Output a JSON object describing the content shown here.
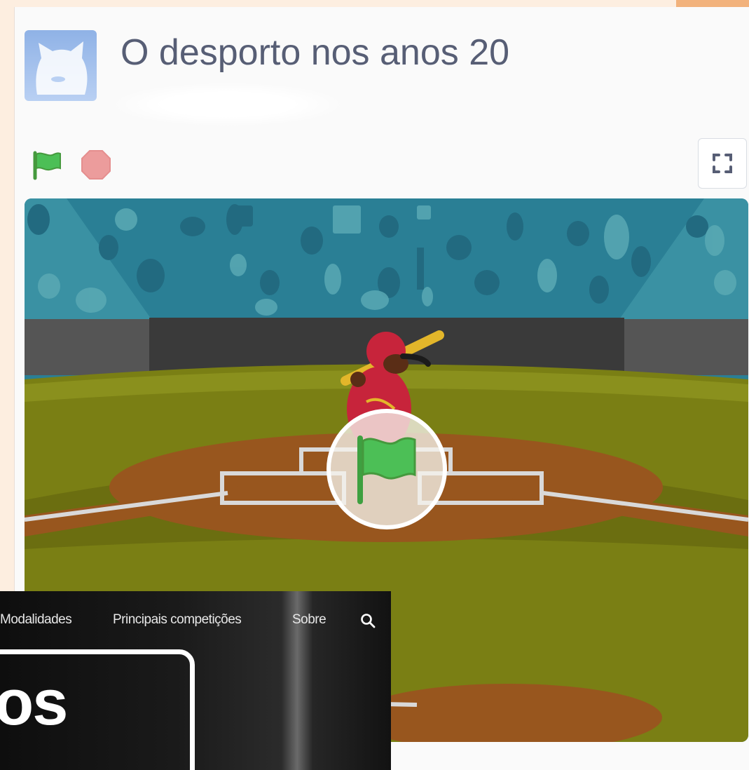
{
  "project": {
    "title": "O desporto nos anos 20"
  },
  "controls": {
    "green_flag_icon": "green-flag-icon",
    "stop_icon": "stop-sign-icon",
    "fullscreen_icon": "fullscreen-icon"
  },
  "stage": {
    "overlay_icon": "green-flag-icon",
    "scene": "baseball batter in stadium"
  },
  "site": {
    "nav": {
      "modalidades": "Modalidades",
      "competicoes": "Principais competições",
      "sobre": "Sobre",
      "search_icon": "search-icon"
    },
    "hero_text": "os"
  },
  "colors": {
    "title": "#575e75",
    "flag_green": "#4cbf56",
    "stop_red": "#ec9c9c",
    "page_background": "#fdeee0"
  }
}
